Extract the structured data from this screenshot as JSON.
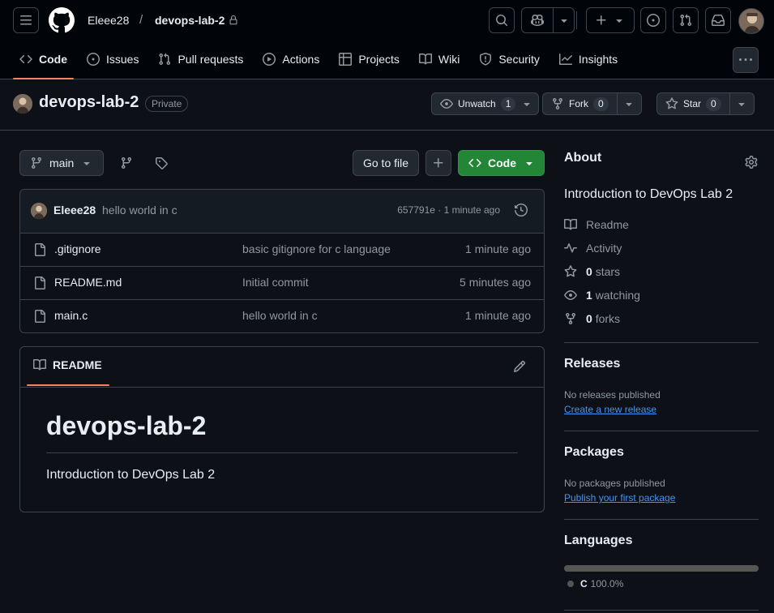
{
  "header": {
    "user": "Eleee28",
    "separator": "/",
    "repo": "devops-lab-2"
  },
  "tabs": [
    {
      "label": "Code",
      "icon": "code-icon",
      "active": true
    },
    {
      "label": "Issues",
      "icon": "issue-icon"
    },
    {
      "label": "Pull requests",
      "icon": "pull-request-icon"
    },
    {
      "label": "Actions",
      "icon": "play-icon"
    },
    {
      "label": "Projects",
      "icon": "table-icon"
    },
    {
      "label": "Wiki",
      "icon": "book-icon"
    },
    {
      "label": "Security",
      "icon": "shield-icon"
    },
    {
      "label": "Insights",
      "icon": "graph-icon"
    }
  ],
  "repo": {
    "title": "devops-lab-2",
    "visibility": "Private",
    "unwatch_label": "Unwatch",
    "watch_count": "1",
    "fork_label": "Fork",
    "fork_count": "0",
    "star_label": "Star",
    "star_count": "0"
  },
  "toolbar": {
    "branch": "main",
    "go_to_file": "Go to file",
    "code_label": "Code"
  },
  "commit": {
    "author": "Eleee28",
    "message": "hello world in c",
    "meta": "657791e · 1 minute ago"
  },
  "files": [
    {
      "name": ".gitignore",
      "message": "basic gitignore for c language",
      "time": "1 minute ago"
    },
    {
      "name": "README.md",
      "message": "Initial commit",
      "time": "5 minutes ago"
    },
    {
      "name": "main.c",
      "message": "hello world in c",
      "time": "1 minute ago"
    }
  ],
  "readme": {
    "tab_label": "README",
    "heading": "devops-lab-2",
    "body": "Introduction to DevOps Lab 2"
  },
  "sidebar": {
    "about_title": "About",
    "description": "Introduction to DevOps Lab 2",
    "readme": "Readme",
    "activity": "Activity",
    "stars_count": "0",
    "stars_label": "stars",
    "watching_count": "1",
    "watching_label": "watching",
    "forks_count": "0",
    "forks_label": "forks",
    "releases_title": "Releases",
    "releases_text": "No releases published",
    "releases_link": "Create a new release",
    "packages_title": "Packages",
    "packages_text": "No packages published",
    "packages_link": "Publish your first package",
    "languages_title": "Languages",
    "language_name": "C",
    "language_percent": "100.0%"
  },
  "colors": {
    "background": "#0d1117",
    "accent_underline": "#f78166",
    "code_button": "#238636",
    "link": "#4493f8",
    "language_c": "#555555"
  }
}
